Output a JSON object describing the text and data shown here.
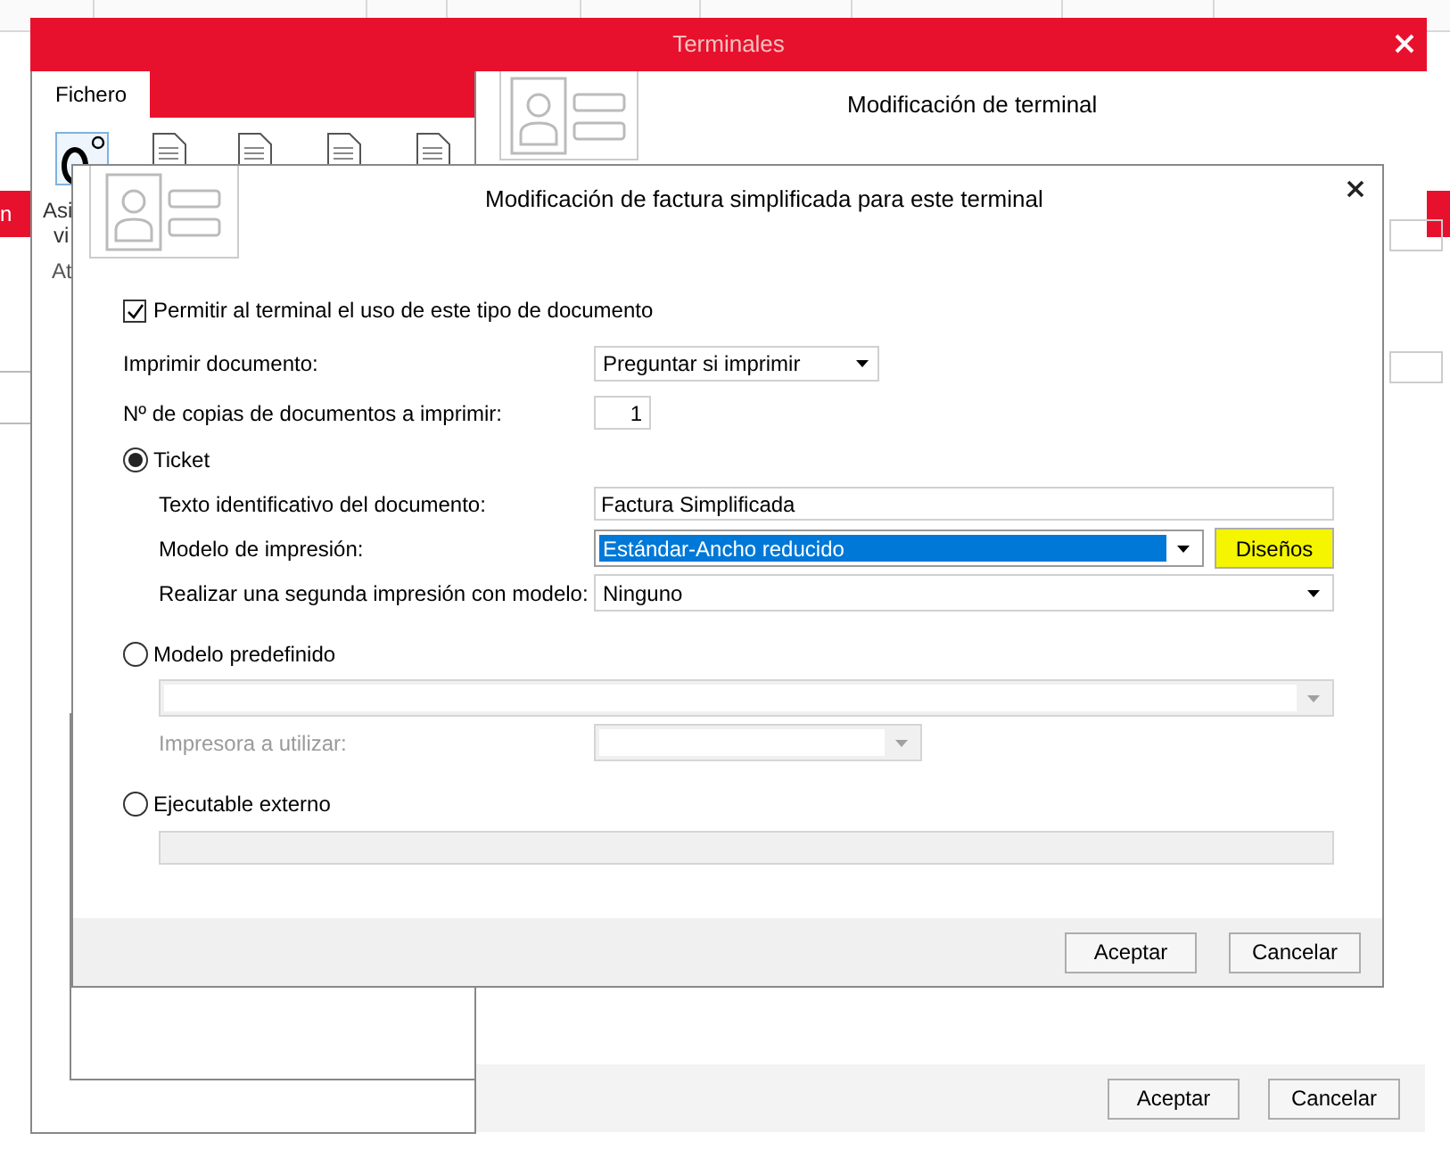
{
  "background_sheet": {
    "side_label": "n"
  },
  "terminales_window": {
    "title": "Terminales",
    "tabs": [
      {
        "label": "Fichero",
        "selected": true
      }
    ],
    "ribbon_labels": [
      "Asi",
      "vi",
      "At"
    ]
  },
  "terminal_window": {
    "title": "Modificación de terminal",
    "buttons": [
      "Aceptar",
      "Cancelar"
    ]
  },
  "dialog": {
    "title": "Modificación de factura simplificada para este terminal",
    "allow": {
      "label": "Permitir al terminal el uso de este tipo de documento",
      "checked": true
    },
    "print_document": {
      "label": "Imprimir documento:",
      "value": "Preguntar si imprimir"
    },
    "copies": {
      "label": "Nº de copias de documentos a imprimir:",
      "value": "1"
    },
    "options": [
      {
        "label": "Ticket",
        "selected": true,
        "fields": [
          {
            "kind": "text",
            "label": "Texto identificativo del documento:",
            "value": "Factura Simplificada",
            "disabled": false
          },
          {
            "kind": "select",
            "label": "Modelo de impresión:",
            "value": "Estándar-Ancho reducido",
            "disabled": false,
            "highlighted": true,
            "button": {
              "label": "Diseños",
              "highlighted": true
            }
          },
          {
            "kind": "select",
            "label": "Realizar una segunda impresión con modelo:",
            "value": "Ninguno",
            "disabled": false,
            "highlighted": false
          }
        ]
      },
      {
        "label": "Modelo predefinido",
        "selected": false,
        "fields": [
          {
            "kind": "select",
            "disabled": true,
            "highlighted": false
          },
          {
            "kind": "short-select",
            "label": "Impresora a utilizar:",
            "disabled": true
          }
        ]
      },
      {
        "label": "Ejecutable externo",
        "selected": false,
        "fields": [
          {
            "kind": "text",
            "disabled": true
          }
        ]
      }
    ],
    "buttons": [
      "Aceptar",
      "Cancelar"
    ]
  }
}
